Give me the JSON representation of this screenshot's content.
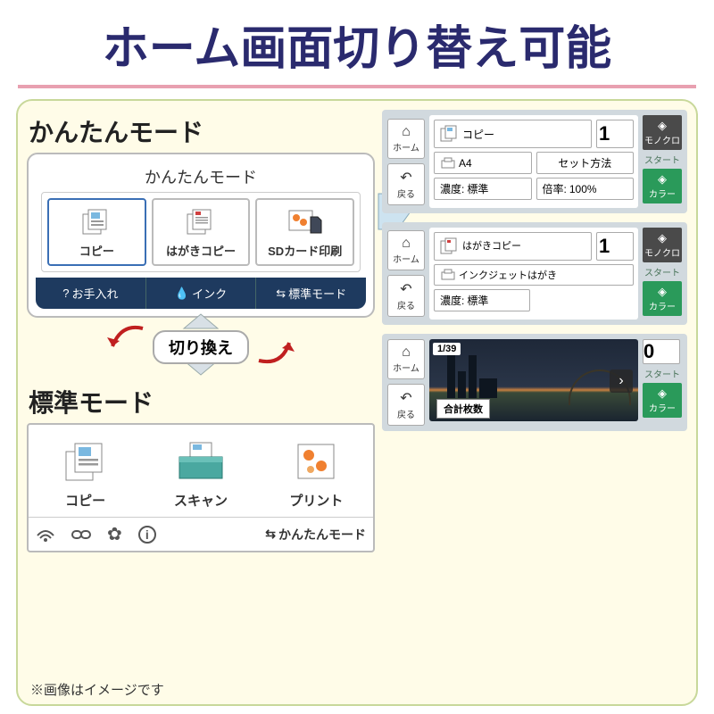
{
  "title": "ホーム画面切り替え可能",
  "easy": {
    "label": "かんたんモード",
    "subheader": "かんたんモード",
    "tiles": [
      {
        "label": "コピー"
      },
      {
        "label": "はがきコピー"
      },
      {
        "label": "SDカード印刷"
      }
    ],
    "bottom": [
      {
        "label": "お手入れ"
      },
      {
        "label": "インク"
      },
      {
        "label": "標準モード"
      }
    ]
  },
  "switch": "切り換え",
  "std": {
    "label": "標準モード",
    "tiles": [
      {
        "label": "コピー"
      },
      {
        "label": "スキャン"
      },
      {
        "label": "プリント"
      }
    ],
    "mode_switch": "かんたんモード"
  },
  "nav": {
    "home": "ホーム",
    "back": "戻る"
  },
  "copy_screen": {
    "title": "コピー",
    "count": "1",
    "paper": "A4",
    "set_method": "セット方法",
    "density_lbl": "濃度:",
    "density_val": "標準",
    "ratio_lbl": "倍率:",
    "ratio_val": "100%"
  },
  "hagaki_screen": {
    "title": "はがきコピー",
    "count": "1",
    "media": "インクジェットはがき",
    "density_lbl": "濃度:",
    "density_val": "標準"
  },
  "photo_screen": {
    "page": "1/39",
    "count": "0",
    "total_label": "合計枚数"
  },
  "side": {
    "mono": "モノクロ",
    "start": "スタート",
    "color": "カラー"
  },
  "footer": "※画像はイメージです"
}
